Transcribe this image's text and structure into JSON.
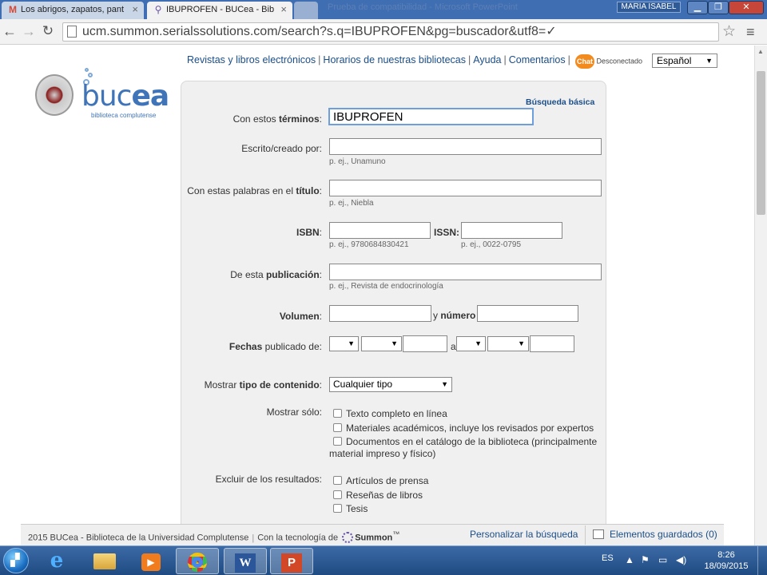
{
  "browser": {
    "tabs": [
      {
        "title": "Los abrigos, zapatos, pant",
        "icon": "gmail-icon",
        "icon_glyph": "M"
      },
      {
        "title": "IBUPROFEN - BUCea - Bib",
        "icon": "summon-icon",
        "icon_glyph": "⚲"
      },
      {
        "title": "",
        "icon": "new-tab-icon"
      }
    ],
    "ghost_title": "Prueba de compatibilidad - Microsoft PowerPoint",
    "user_name": "MARIA ISABEL",
    "window_buttons": {
      "minimize": "▁",
      "maximize": "❐",
      "close": "✕"
    },
    "nav": {
      "back": "←",
      "forward": "→",
      "reload": "↻"
    },
    "url": "ucm.summon.serialssolutions.com/search?s.q=IBUPROFEN&pg=buscador&utf8=✓",
    "star_glyph": "☆",
    "menu_glyph": "≡"
  },
  "header": {
    "links": [
      "Revistas y libros electrónicos",
      "Horarios de nuestras bibliotecas",
      "Ayuda",
      "Comentarios"
    ],
    "separator": "|",
    "chat": {
      "icon_text": "Chat",
      "status": "Desconectado"
    },
    "language": "Español"
  },
  "logo": {
    "brand_light": "buc",
    "brand_bold": "ea",
    "tagline": "biblioteca complutense"
  },
  "form": {
    "basic_search_link": "Búsqueda básica",
    "terms": {
      "label_pre": "Con estos ",
      "label_bold": "términos",
      "label_post": ":",
      "value": "IBUPROFEN"
    },
    "author": {
      "label_pre": "Escrito/creado por:",
      "hint": "p. ej., Unamuno"
    },
    "title": {
      "label_pre": "Con estas palabras en el ",
      "label_bold": "título",
      "label_post": ":",
      "hint": "p. ej., Niebla"
    },
    "isbn": {
      "label_bold": "ISBN",
      "label_post": ":",
      "hint": "p. ej., 9780684830421"
    },
    "issn": {
      "label_bold": "ISSN:",
      "hint": "p. ej., 0022-0795"
    },
    "publication": {
      "label_pre": "De esta ",
      "label_bold": "publicación",
      "label_post": ":",
      "hint": "p. ej., Revista de endocrinología"
    },
    "volume": {
      "label_bold": "Volumen",
      "label_post": ":",
      "number_pre": "y ",
      "number_bold": "número"
    },
    "dates": {
      "label_bold": "Fechas",
      "label_post": " publicado de:",
      "to_label": "a"
    },
    "content_type": {
      "label_pre": "Mostrar ",
      "label_bold": "tipo de contenido",
      "label_post": ":",
      "selected": "Cualquier tipo"
    },
    "show_only": {
      "label": "Mostrar sólo:",
      "options": [
        "Texto completo en línea",
        "Materiales académicos, incluye los revisados por expertos",
        "Documentos en el catálogo de la biblioteca (principalmente"
      ],
      "option3_line2": "material impreso y físico)"
    },
    "exclude": {
      "label": "Excluir de los resultados:",
      "options": [
        "Artículos de prensa",
        "Reseñas de libros",
        "Tesis"
      ]
    },
    "select_arrow": "▼"
  },
  "footer": {
    "copyright": "2015 BUCea - Biblioteca de la Universidad Complutense",
    "powered_by": "Con la tecnología de",
    "summon": "Summon",
    "summon_tm": "™",
    "customize": "Personalizar la búsqueda",
    "saved_items": "Elementos guardados (0)"
  },
  "taskbar": {
    "apps": [
      "internet-explorer",
      "file-explorer",
      "media-player",
      "chrome",
      "word",
      "powerpoint"
    ],
    "ie_glyph": "e",
    "media_glyph": "▶",
    "word_glyph": "W",
    "ppt_glyph": "P",
    "language": "ES",
    "tray_glyphs": [
      "▲",
      "⚑",
      "▭",
      "◀)"
    ],
    "time": "8:26",
    "date": "18/09/2015"
  },
  "colors": {
    "link": "#1a4e8a",
    "brand_blue": "#3f74b8",
    "panel_bg": "#f0f0f0",
    "focus_border": "#6d9fdc"
  }
}
